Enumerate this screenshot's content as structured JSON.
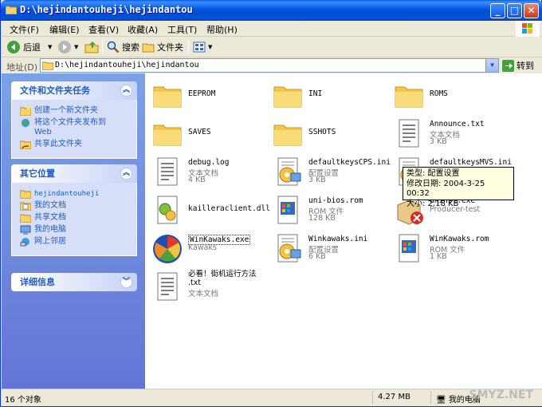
{
  "window": {
    "title": "D:\\hejindantouheji\\hejindantou"
  },
  "menu": [
    "文件(F)",
    "编辑(E)",
    "查看(V)",
    "收藏(A)",
    "工具(T)",
    "帮助(H)"
  ],
  "toolbar": {
    "back": "后退",
    "search": "搜索",
    "folders": "文件夹"
  },
  "address": {
    "label": "地址(D)",
    "value": "D:\\hejindantouheji\\hejindantou",
    "go": "转到"
  },
  "side": {
    "tasks_title": "文件和文件夹任务",
    "tasks": [
      "创建一个新文件夹",
      "将这个文件夹发布到\nWeb",
      "共享此文件夹"
    ],
    "places_title": "其它位置",
    "places": [
      "hejindantouheji",
      "我的文档",
      "共享文档",
      "我的电脑",
      "网上邻居"
    ],
    "details_title": "详细信息"
  },
  "files": [
    {
      "name": "EEPROM",
      "kind": "folder"
    },
    {
      "name": "INI",
      "kind": "folder"
    },
    {
      "name": "ROMS",
      "kind": "folder"
    },
    {
      "name": "SAVES",
      "kind": "folder"
    },
    {
      "name": "SSHOTS",
      "kind": "folder"
    },
    {
      "name": "Announce.txt",
      "type": "文本文档",
      "size": "3 KB",
      "kind": "txt"
    },
    {
      "name": "debug.log",
      "type": "文本文档",
      "size": "4 KB",
      "kind": "txt"
    },
    {
      "name": "defaultkeysCPS.ini",
      "type": "配置设置",
      "size": "3 KB",
      "kind": "ini"
    },
    {
      "name": "defaultkeysMVS.ini",
      "type": "",
      "size": "",
      "kind": "ini"
    },
    {
      "name": "kailleraclient.dll",
      "kind": "dll"
    },
    {
      "name": "uni-bios.rom",
      "type": "ROM 文件",
      "size": "128 KB",
      "kind": "rom"
    },
    {
      "name": "unInst.exe",
      "type": "Producer-test",
      "size": "",
      "kind": "uninst"
    },
    {
      "name": "WinKawaks.exe",
      "type": "Kawaks",
      "size": "",
      "kind": "exe"
    },
    {
      "name": "Winkawaks.ini",
      "type": "配置设置",
      "size": "6 KB",
      "kind": "ini"
    },
    {
      "name": "WinKawaks.rom",
      "type": "ROM 文件",
      "size": "1 KB",
      "kind": "rom"
    },
    {
      "name": "必看！街机运行方法\n.txt",
      "type": "文本文档",
      "size": "",
      "kind": "txt"
    }
  ],
  "tooltip": {
    "line1": "类型: 配置设置",
    "line2": "修改日期: 2004-3-25 00:32",
    "line3": "大小: 2.18 KB"
  },
  "status": {
    "count": "16 个对象",
    "size": "4.27 MB",
    "location": "我的电脑"
  },
  "watermark": "SMYZ.NET"
}
